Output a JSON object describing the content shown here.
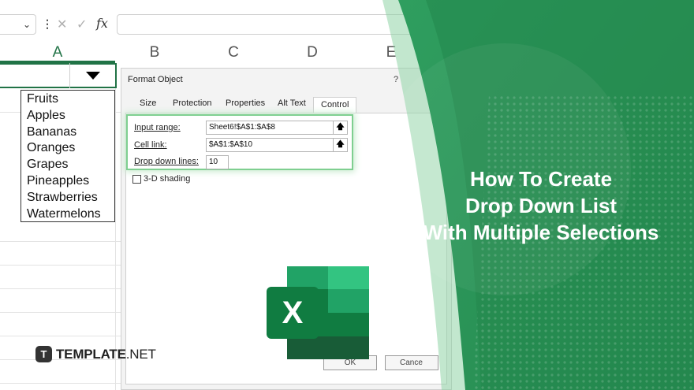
{
  "formula_bar": {
    "fx_symbol": "fx"
  },
  "columns": [
    "A",
    "B",
    "C",
    "D",
    "E"
  ],
  "dropdown_list": {
    "items": [
      "Fruits",
      "Apples",
      "Bananas",
      "Oranges",
      "Grapes",
      "Pineapples",
      "Strawberries",
      "Watermelons"
    ]
  },
  "dialog": {
    "title": "Format Object",
    "help": "?",
    "tabs": [
      "Size",
      "Protection",
      "Properties",
      "Alt Text",
      "Control"
    ],
    "active_tab": "Control",
    "fields": {
      "input_range_label": "Input range:",
      "input_range_value": "Sheet6!$A$1:$A$8",
      "cell_link_label": "Cell link:",
      "cell_link_value": "$A$1:$A$10",
      "dropdown_lines_label": "Drop down lines:",
      "dropdown_lines_value": "10",
      "shading_label": "3-D shading"
    },
    "ok_label": "OK",
    "cancel_label": "Cance"
  },
  "banner": {
    "headline_lines": [
      "How To Create",
      "Drop Down List",
      "With Multiple Selections"
    ],
    "brand_badge": "T",
    "brand_name": "TEMPLATE",
    "brand_suffix": ".NET",
    "excel_letter": "X"
  },
  "colors": {
    "excel_green": "#217346",
    "banner_green": "#2e9a5c",
    "banner_dark_green": "#1f7a44",
    "headline_text": "#ffffff"
  }
}
